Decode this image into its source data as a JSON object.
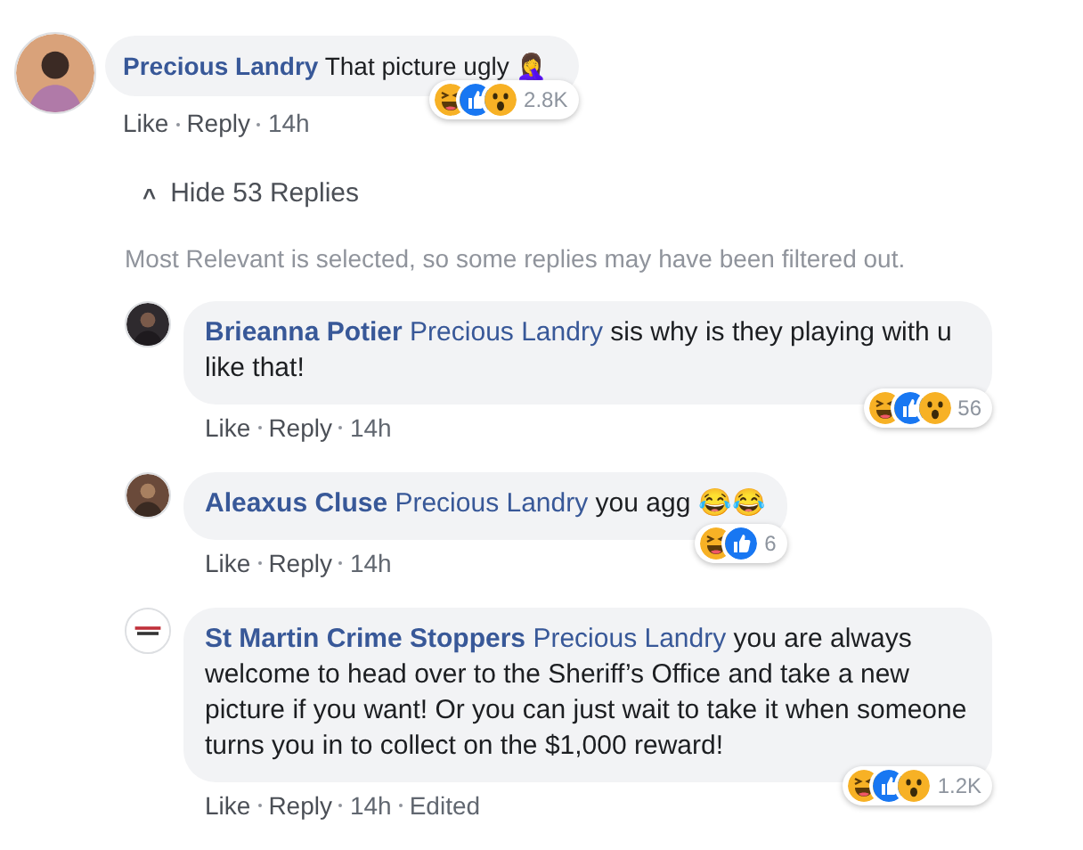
{
  "comment": {
    "author": "Precious Landry",
    "text": "That picture ugly 🤦‍♀️",
    "actions": [
      "Like",
      "Reply",
      "14h"
    ],
    "reactions": {
      "kinds": [
        {
          "kind": "haha"
        },
        {
          "kind": "like"
        },
        {
          "kind": "wow"
        }
      ],
      "count": "2.8K"
    }
  },
  "replies_toggle": {
    "icon": "^",
    "label": "Hide 53 Replies"
  },
  "notice": "Most Relevant is selected, so some replies may have been filtered out.",
  "replies": [
    {
      "author": "Brieanna Potier",
      "mention": "Precious Landry",
      "text": "sis why is they playing with u like that!",
      "actions": [
        "Like",
        "Reply",
        "14h"
      ],
      "reactions": {
        "kinds": [
          {
            "kind": "haha"
          },
          {
            "kind": "like"
          },
          {
            "kind": "wow"
          }
        ],
        "count": "56"
      }
    },
    {
      "author": "Aleaxus Cluse",
      "mention": "Precious Landry",
      "text": "you agg 😂😂",
      "actions": [
        "Like",
        "Reply",
        "14h"
      ],
      "reactions": {
        "kinds": [
          {
            "kind": "haha"
          },
          {
            "kind": "like"
          }
        ],
        "count": "6"
      }
    },
    {
      "author": "St Martin Crime Stoppers",
      "mention": "Precious Landry",
      "text": "you are always welcome to head over to the Sheriff’s Office and take a new picture if you want! Or you can just wait to take it when someone turns you in to collect on the $1,000 reward!",
      "actions": [
        "Like",
        "Reply",
        "14h",
        "Edited"
      ],
      "reactions": {
        "kinds": [
          {
            "kind": "haha"
          },
          {
            "kind": "like"
          },
          {
            "kind": "wow"
          }
        ],
        "count": "1.2K"
      }
    }
  ]
}
